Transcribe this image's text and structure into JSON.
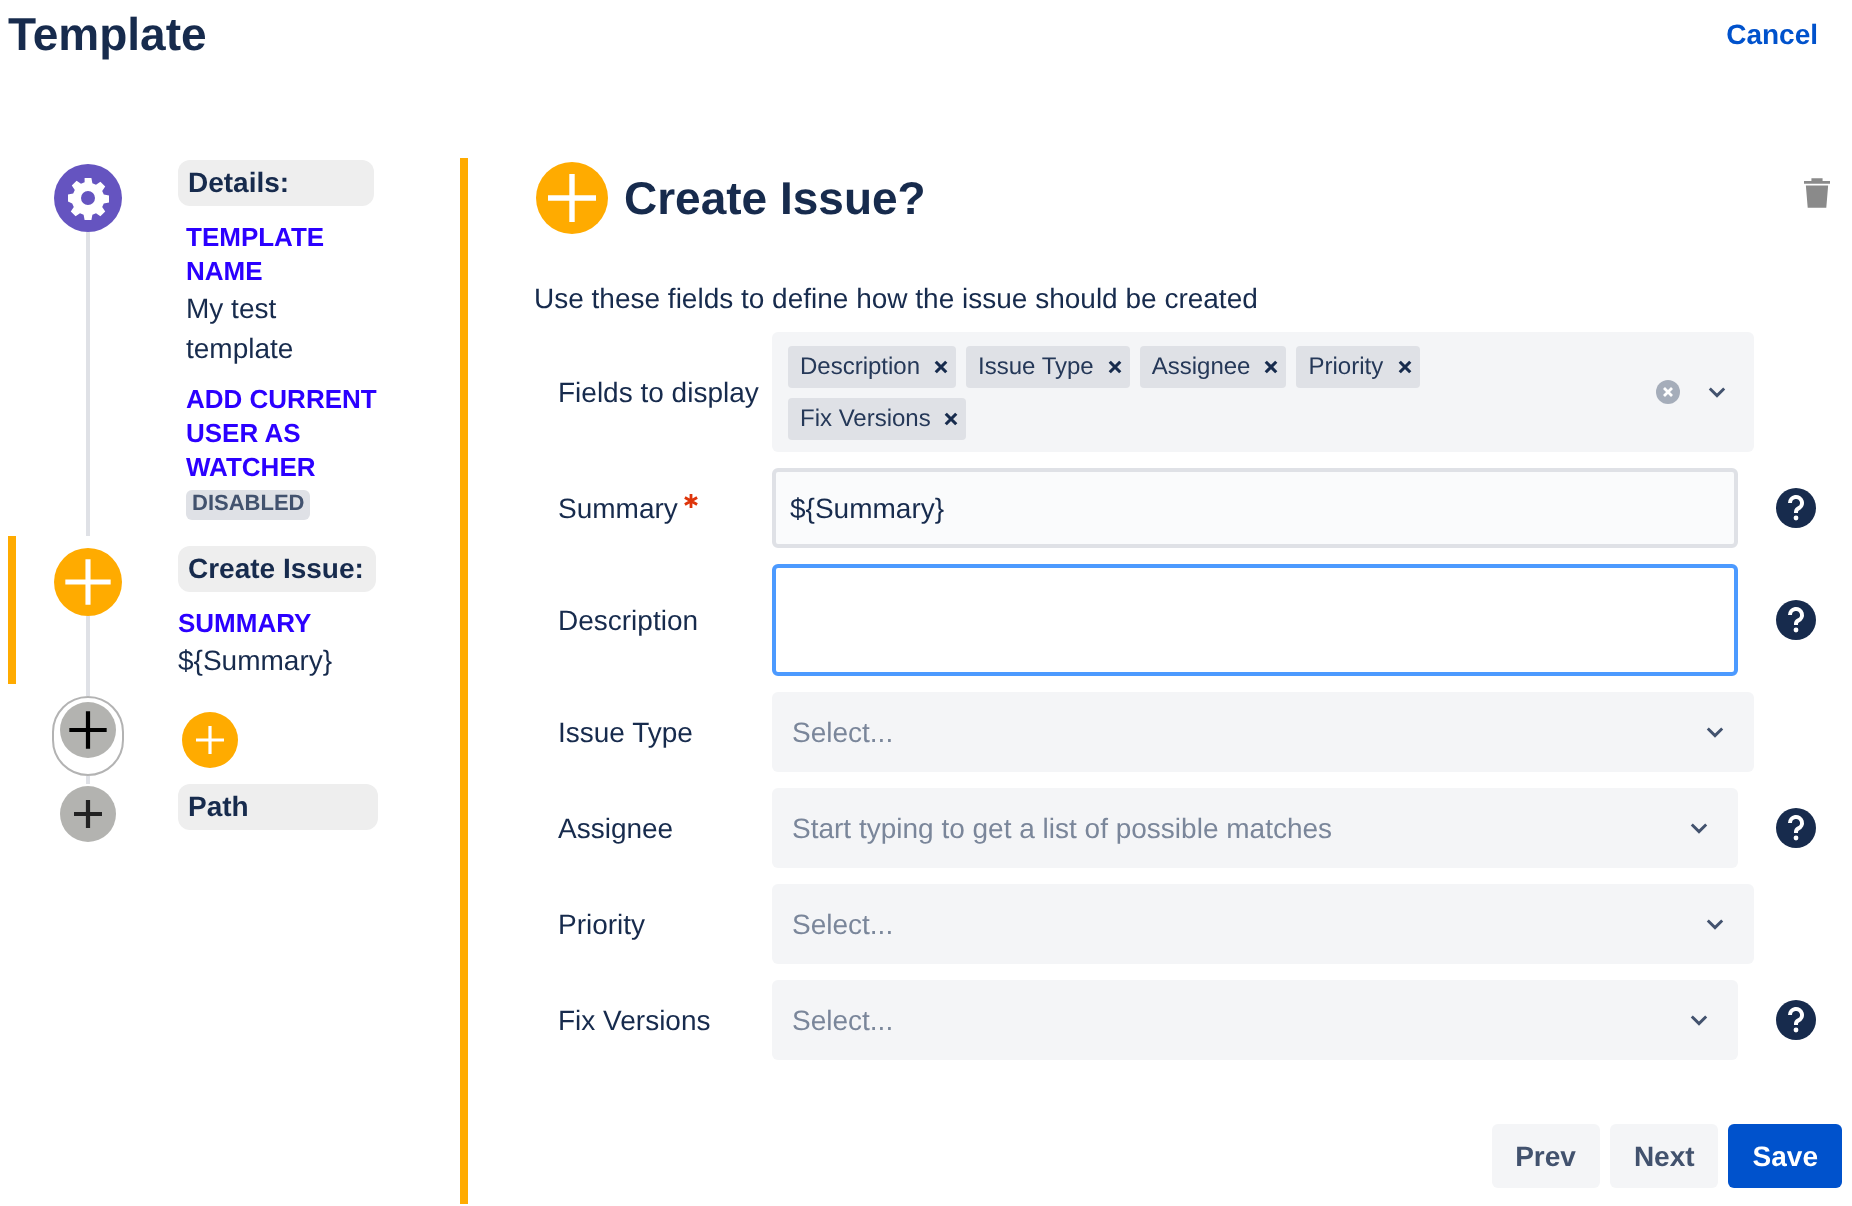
{
  "header": {
    "title": "Template",
    "cancel": "Cancel"
  },
  "steps": [
    {
      "kind": "details",
      "label": "Details:",
      "selected": false,
      "fields": [
        {
          "kind": "text",
          "name": "TEMPLATE NAME",
          "value": "My test template"
        },
        {
          "kind": "badge",
          "name": "ADD CURRENT USER AS WATCHER",
          "value": "DISABLED"
        }
      ]
    },
    {
      "kind": "create",
      "label": "Create Issue:",
      "selected": true,
      "fields": [
        {
          "kind": "text",
          "name": "SUMMARY",
          "value": "${Summary}"
        }
      ]
    },
    {
      "kind": "add",
      "selected": false
    },
    {
      "kind": "path",
      "label": "Path",
      "selected": false
    }
  ],
  "form": {
    "heading": "Create Issue?",
    "intro": "Use these fields to define how the issue should be created",
    "fields": [
      {
        "kind": "tags",
        "label": "Fields to display",
        "required": false,
        "help": false,
        "tags": [
          "Description",
          "Issue Type",
          "Assignee",
          "Priority",
          "Fix Versions"
        ]
      },
      {
        "kind": "text",
        "label": "Summary",
        "required": true,
        "help": true,
        "focused": false,
        "value": "${Summary}"
      },
      {
        "kind": "textarea",
        "label": "Description",
        "required": false,
        "help": true,
        "focused": true
      },
      {
        "kind": "select",
        "label": "Issue Type",
        "required": false,
        "help": false,
        "placeholder": "Select..."
      },
      {
        "kind": "select",
        "label": "Assignee",
        "required": false,
        "help": true,
        "placeholder": "Start typing to get a list of possible matches"
      },
      {
        "kind": "select",
        "label": "Priority",
        "required": false,
        "help": false,
        "placeholder": "Select..."
      },
      {
        "kind": "select",
        "label": "Fix Versions",
        "required": false,
        "help": true,
        "placeholder": "Select..."
      }
    ]
  },
  "buttons": [
    {
      "label": "Prev",
      "primary": false
    },
    {
      "label": "Next",
      "primary": false
    },
    {
      "label": "Save",
      "primary": true
    }
  ]
}
